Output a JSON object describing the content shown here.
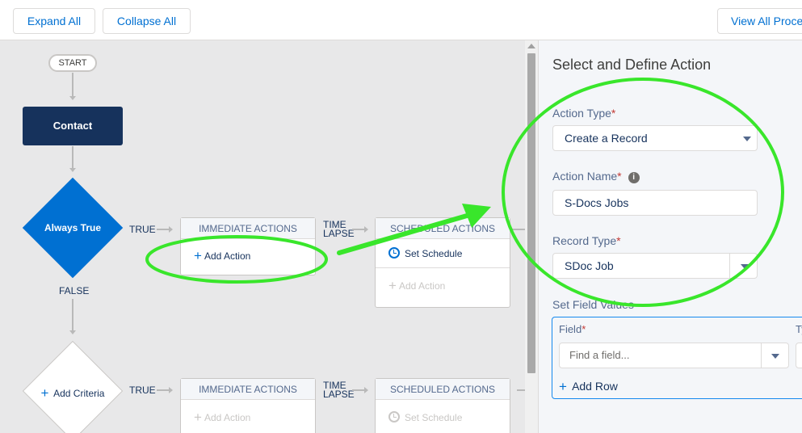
{
  "toolbar": {
    "expand_all": "Expand All",
    "collapse_all": "Collapse All",
    "view_all": "View All Proce"
  },
  "flow": {
    "start": "START",
    "object": "Contact",
    "criteria_1": "Always True",
    "criteria_2": "Add Criteria",
    "true_label": "TRUE",
    "false_label": "FALSE",
    "time_label": "TIME",
    "lapse_label": "LAPSE",
    "immediate_header": "IMMEDIATE ACTIONS",
    "scheduled_header": "SCHEDULED ACTIONS",
    "add_action": "Add Action",
    "set_schedule": "Set Schedule"
  },
  "panel": {
    "title": "Select and Define Action",
    "action_type_label": "Action Type",
    "action_type_value": "Create a Record",
    "action_name_label": "Action Name",
    "action_name_value": "S-Docs Jobs",
    "record_type_label": "Record Type",
    "record_type_value": "SDoc Job",
    "set_field_values_label": "Set Field Values",
    "field_label": "Field",
    "type_label_partial": "Ty",
    "find_field_placeholder": "Find a field...",
    "add_row": "Add Row",
    "required_mark": "*",
    "info_glyph": "i"
  },
  "colors": {
    "brand_blue": "#0070d2",
    "navy": "#16325c",
    "highlight_green": "#39e62b"
  }
}
